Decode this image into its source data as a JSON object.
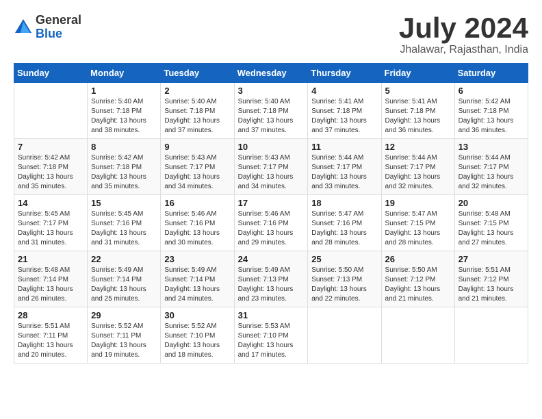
{
  "logo": {
    "general": "General",
    "blue": "Blue"
  },
  "title": "July 2024",
  "location": "Jhalawar, Rajasthan, India",
  "days_header": [
    "Sunday",
    "Monday",
    "Tuesday",
    "Wednesday",
    "Thursday",
    "Friday",
    "Saturday"
  ],
  "weeks": [
    [
      {
        "day": "",
        "info": ""
      },
      {
        "day": "1",
        "info": "Sunrise: 5:40 AM\nSunset: 7:18 PM\nDaylight: 13 hours\nand 38 minutes."
      },
      {
        "day": "2",
        "info": "Sunrise: 5:40 AM\nSunset: 7:18 PM\nDaylight: 13 hours\nand 37 minutes."
      },
      {
        "day": "3",
        "info": "Sunrise: 5:40 AM\nSunset: 7:18 PM\nDaylight: 13 hours\nand 37 minutes."
      },
      {
        "day": "4",
        "info": "Sunrise: 5:41 AM\nSunset: 7:18 PM\nDaylight: 13 hours\nand 37 minutes."
      },
      {
        "day": "5",
        "info": "Sunrise: 5:41 AM\nSunset: 7:18 PM\nDaylight: 13 hours\nand 36 minutes."
      },
      {
        "day": "6",
        "info": "Sunrise: 5:42 AM\nSunset: 7:18 PM\nDaylight: 13 hours\nand 36 minutes."
      }
    ],
    [
      {
        "day": "7",
        "info": "Sunrise: 5:42 AM\nSunset: 7:18 PM\nDaylight: 13 hours\nand 35 minutes."
      },
      {
        "day": "8",
        "info": "Sunrise: 5:42 AM\nSunset: 7:18 PM\nDaylight: 13 hours\nand 35 minutes."
      },
      {
        "day": "9",
        "info": "Sunrise: 5:43 AM\nSunset: 7:17 PM\nDaylight: 13 hours\nand 34 minutes."
      },
      {
        "day": "10",
        "info": "Sunrise: 5:43 AM\nSunset: 7:17 PM\nDaylight: 13 hours\nand 34 minutes."
      },
      {
        "day": "11",
        "info": "Sunrise: 5:44 AM\nSunset: 7:17 PM\nDaylight: 13 hours\nand 33 minutes."
      },
      {
        "day": "12",
        "info": "Sunrise: 5:44 AM\nSunset: 7:17 PM\nDaylight: 13 hours\nand 32 minutes."
      },
      {
        "day": "13",
        "info": "Sunrise: 5:44 AM\nSunset: 7:17 PM\nDaylight: 13 hours\nand 32 minutes."
      }
    ],
    [
      {
        "day": "14",
        "info": "Sunrise: 5:45 AM\nSunset: 7:17 PM\nDaylight: 13 hours\nand 31 minutes."
      },
      {
        "day": "15",
        "info": "Sunrise: 5:45 AM\nSunset: 7:16 PM\nDaylight: 13 hours\nand 31 minutes."
      },
      {
        "day": "16",
        "info": "Sunrise: 5:46 AM\nSunset: 7:16 PM\nDaylight: 13 hours\nand 30 minutes."
      },
      {
        "day": "17",
        "info": "Sunrise: 5:46 AM\nSunset: 7:16 PM\nDaylight: 13 hours\nand 29 minutes."
      },
      {
        "day": "18",
        "info": "Sunrise: 5:47 AM\nSunset: 7:16 PM\nDaylight: 13 hours\nand 28 minutes."
      },
      {
        "day": "19",
        "info": "Sunrise: 5:47 AM\nSunset: 7:15 PM\nDaylight: 13 hours\nand 28 minutes."
      },
      {
        "day": "20",
        "info": "Sunrise: 5:48 AM\nSunset: 7:15 PM\nDaylight: 13 hours\nand 27 minutes."
      }
    ],
    [
      {
        "day": "21",
        "info": "Sunrise: 5:48 AM\nSunset: 7:14 PM\nDaylight: 13 hours\nand 26 minutes."
      },
      {
        "day": "22",
        "info": "Sunrise: 5:49 AM\nSunset: 7:14 PM\nDaylight: 13 hours\nand 25 minutes."
      },
      {
        "day": "23",
        "info": "Sunrise: 5:49 AM\nSunset: 7:14 PM\nDaylight: 13 hours\nand 24 minutes."
      },
      {
        "day": "24",
        "info": "Sunrise: 5:49 AM\nSunset: 7:13 PM\nDaylight: 13 hours\nand 23 minutes."
      },
      {
        "day": "25",
        "info": "Sunrise: 5:50 AM\nSunset: 7:13 PM\nDaylight: 13 hours\nand 22 minutes."
      },
      {
        "day": "26",
        "info": "Sunrise: 5:50 AM\nSunset: 7:12 PM\nDaylight: 13 hours\nand 21 minutes."
      },
      {
        "day": "27",
        "info": "Sunrise: 5:51 AM\nSunset: 7:12 PM\nDaylight: 13 hours\nand 21 minutes."
      }
    ],
    [
      {
        "day": "28",
        "info": "Sunrise: 5:51 AM\nSunset: 7:11 PM\nDaylight: 13 hours\nand 20 minutes."
      },
      {
        "day": "29",
        "info": "Sunrise: 5:52 AM\nSunset: 7:11 PM\nDaylight: 13 hours\nand 19 minutes."
      },
      {
        "day": "30",
        "info": "Sunrise: 5:52 AM\nSunset: 7:10 PM\nDaylight: 13 hours\nand 18 minutes."
      },
      {
        "day": "31",
        "info": "Sunrise: 5:53 AM\nSunset: 7:10 PM\nDaylight: 13 hours\nand 17 minutes."
      },
      {
        "day": "",
        "info": ""
      },
      {
        "day": "",
        "info": ""
      },
      {
        "day": "",
        "info": ""
      }
    ]
  ]
}
